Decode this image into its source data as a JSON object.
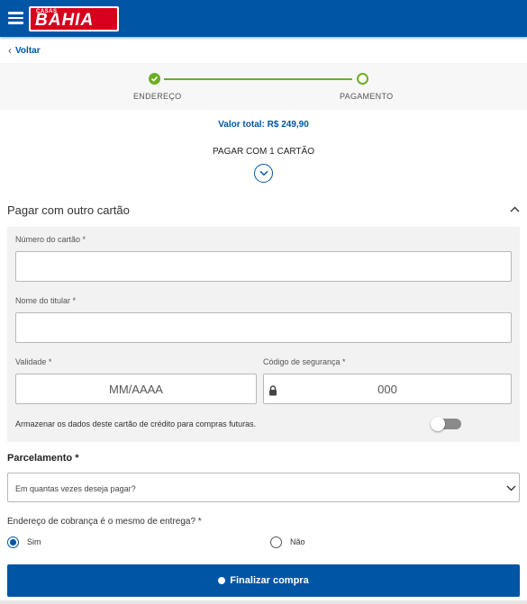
{
  "header": {
    "logo_small": "CASAS",
    "logo_big": "BAHIA",
    "brand_color": "#0055a5",
    "logo_color": "#d6001c"
  },
  "nav": {
    "back_label": "Voltar"
  },
  "steps": {
    "items": [
      {
        "label": "ENDEREÇO",
        "status": "done"
      },
      {
        "label": "PAGAMENTO",
        "status": "current"
      }
    ],
    "done_color": "#6ab023"
  },
  "summary": {
    "total": "Valor total: R$ 249,90",
    "pay_one_card": "PAGAR COM 1 CARTÃO"
  },
  "card_form": {
    "section_title": "Pagar com outro cartão",
    "card_number_label": "Número do cartão *",
    "card_number_value": "",
    "holder_label": "Nome do titular *",
    "holder_value": "",
    "expiry_label": "Validade *",
    "expiry_placeholder": "MM/AAAA",
    "cvv_label": "Código de segurança *",
    "cvv_placeholder": "000",
    "store_card_label": "Armazenar os dados deste cartão de crédito para compras futuras.",
    "store_card_enabled": false
  },
  "installments": {
    "title": "Parcelamento *",
    "placeholder": "Em quantas vezes deseja pagar?"
  },
  "billing": {
    "question": "Endereço de cobrança é o mesmo de entrega? *",
    "options": [
      {
        "label": "Sim",
        "selected": true
      },
      {
        "label": "Não",
        "selected": false
      }
    ]
  },
  "submit": {
    "label": "Finalizar compra"
  }
}
